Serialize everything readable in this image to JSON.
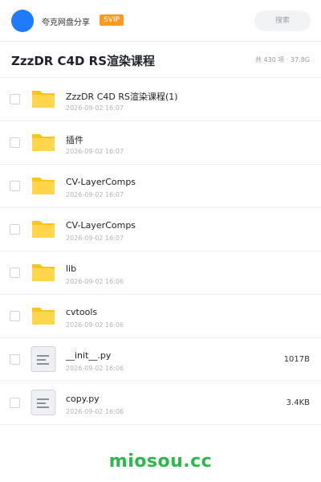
{
  "header": {
    "username": "夸克网盘分享",
    "badge": "SVIP",
    "search_placeholder": "搜索"
  },
  "title_bar": {
    "title": "ZzzDR C4D RS渲染课程",
    "summary": "共 430 项 · 37.8G"
  },
  "files": [
    {
      "type": "folder",
      "name": "ZzzDR C4D RS渲染课程(1)",
      "date": "2026-09-02 16:07",
      "size": ""
    },
    {
      "type": "folder",
      "name": "插件",
      "date": "2026-09-02 16:07",
      "size": ""
    },
    {
      "type": "folder",
      "name": "CV-LayerComps",
      "date": "2026-09-02 16:07",
      "size": ""
    },
    {
      "type": "folder",
      "name": "CV-LayerComps",
      "date": "2026-09-02 16:07",
      "size": ""
    },
    {
      "type": "folder",
      "name": "lib",
      "date": "2026-09-02 16:06",
      "size": ""
    },
    {
      "type": "folder",
      "name": "cvtools",
      "date": "2026-09-02 16:06",
      "size": ""
    },
    {
      "type": "file",
      "name": "__init__.py",
      "date": "2026-09-02 16:06",
      "size": "1017B"
    },
    {
      "type": "file",
      "name": "copy.py",
      "date": "2026-09-02 16:06",
      "size": "3.4KB"
    }
  ],
  "watermark": "miosou.cc",
  "colors": {
    "accent_blue": "#1e7bff",
    "svip_orange": "#ff9a1f",
    "folder_yellow": "#ffc51c",
    "watermark_green": "#2db84d"
  },
  "icons": {
    "folder": "folder-icon",
    "file": "document-icon"
  }
}
